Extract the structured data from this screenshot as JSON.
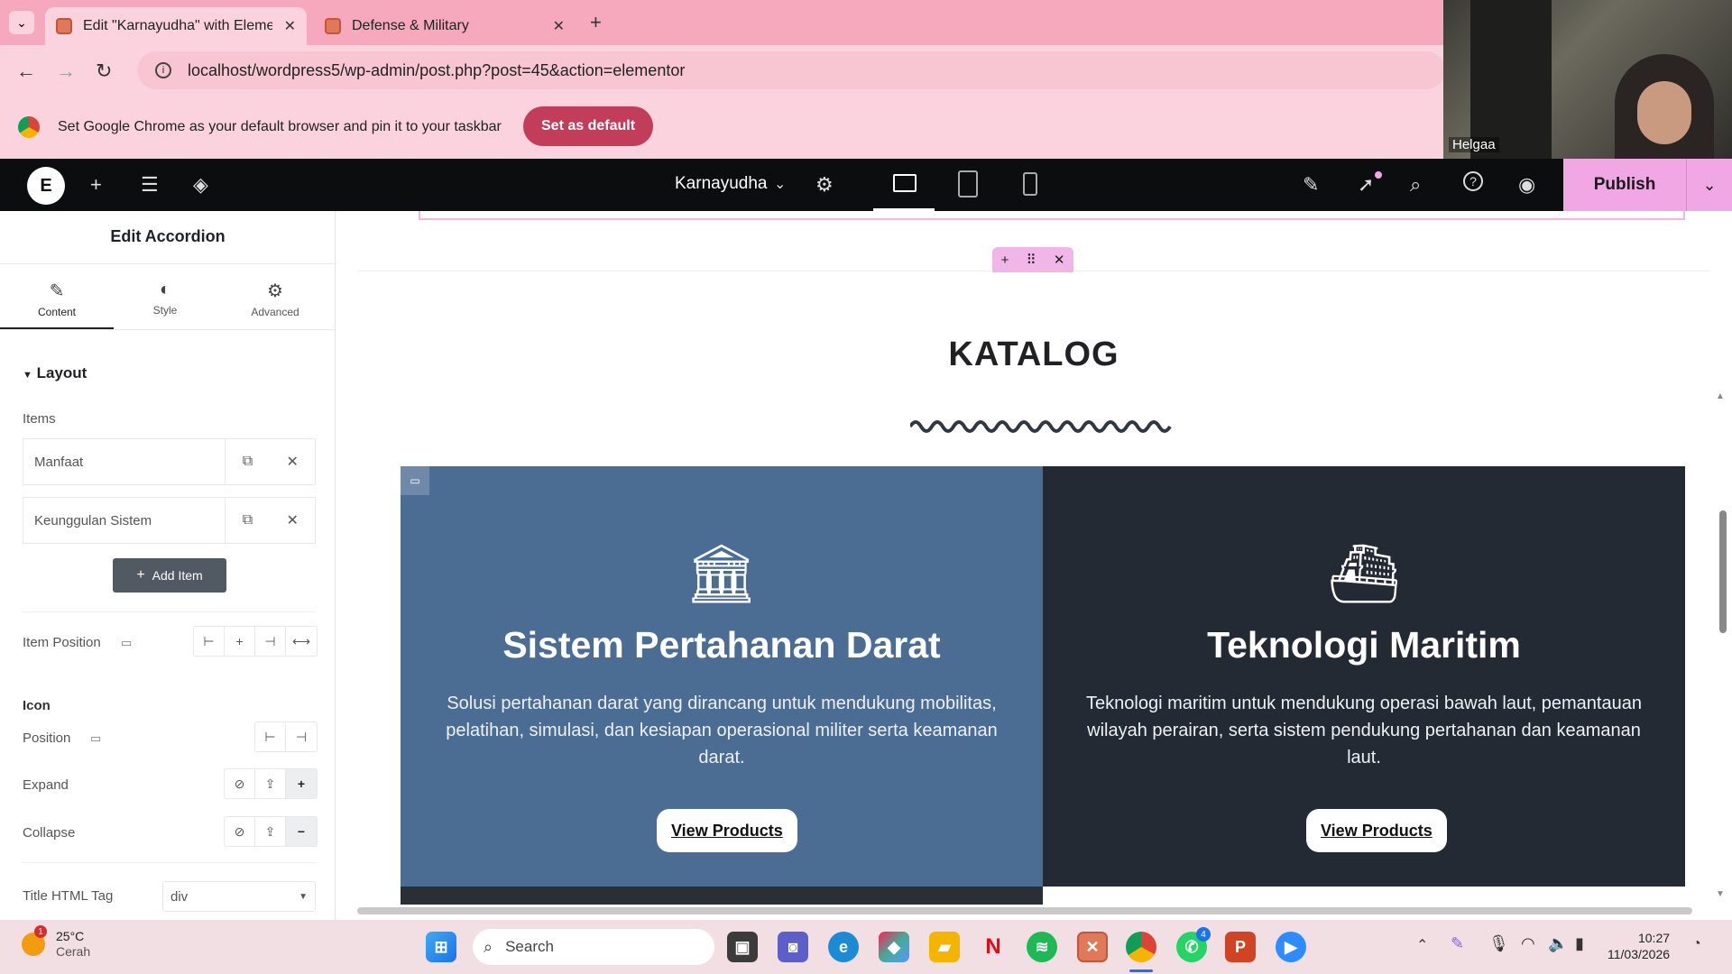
{
  "browser": {
    "tabs": [
      {
        "label": "Edit \"Karnayudha\" with Element",
        "active": true
      },
      {
        "label": "Defense & Military",
        "active": false
      }
    ],
    "url": "localhost/wordpress5/wp-admin/post.php?post=45&action=elementor",
    "infobar_text": "Set Google Chrome as your default browser and pin it to your taskbar",
    "set_default_label": "Set as default",
    "webcam_name": "Helgaa"
  },
  "elementor": {
    "site_name": "Karnayudha",
    "publish_label": "Publish",
    "panel": {
      "title": "Edit Accordion",
      "tabs": [
        "Content",
        "Style",
        "Advanced"
      ],
      "section": "Layout",
      "items_label": "Items",
      "items": [
        "Manfaat",
        "Keunggulan Sistem"
      ],
      "add_item_label": "Add Item",
      "item_position_label": "Item Position",
      "icon_heading": "Icon",
      "position_label": "Position",
      "expand_label": "Expand",
      "collapse_label": "Collapse",
      "title_tag_label": "Title HTML Tag",
      "title_tag_value": "div"
    }
  },
  "canvas": {
    "heading": "KATALOG",
    "cards": [
      {
        "icon": "bank-icon",
        "title": "Sistem Pertahanan Darat",
        "text": "Solusi pertahanan darat yang dirancang untuk mendukung mobilitas, pelatihan, simulasi, dan kesiapan operasional militer serta keamanan darat.",
        "button": "View Products"
      },
      {
        "icon": "ship-icon",
        "title": "Teknologi Maritim",
        "text": "Teknologi maritim untuk mendukung operasi bawah laut, pemantauan wilayah perairan, serta sistem pendukung pertahanan dan keamanan laut.",
        "button": "View Products"
      }
    ]
  },
  "taskbar": {
    "weather_temp": "25°C",
    "weather_desc": "Cerah",
    "weather_badge": "1",
    "search_placeholder": "Search",
    "whatsapp_badge": "4",
    "time": "10:27",
    "date": "11/03/2026"
  },
  "colors": {
    "chrome_pink": "#f6a8bd",
    "publish": "#f0a7e3",
    "card_left": "#4b6d94",
    "card_right": "#242a33"
  }
}
